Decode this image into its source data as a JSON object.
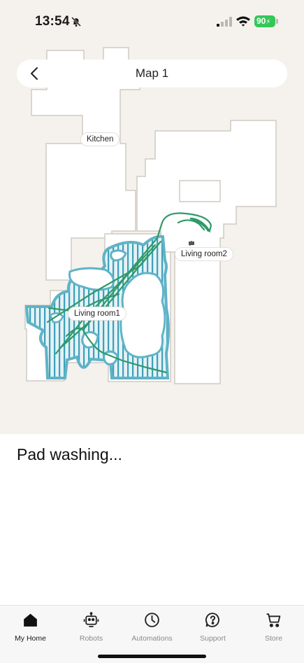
{
  "status_bar": {
    "time": "13:54",
    "battery": "90"
  },
  "header": {
    "title": "Map 1"
  },
  "map": {
    "rooms": [
      {
        "name": "Kitchen"
      },
      {
        "name": "Living room1"
      },
      {
        "name": "Living room2"
      }
    ],
    "colors": {
      "background": "#f5f1ec",
      "floor": "#ffffff",
      "cleaned_area": "#5fb3c8",
      "path": "#2e9968"
    }
  },
  "status": {
    "text": "Pad washing..."
  },
  "tabs": [
    {
      "label": "My Home",
      "icon": "home-icon",
      "active": true
    },
    {
      "label": "Robots",
      "icon": "robot-icon",
      "active": false
    },
    {
      "label": "Automations",
      "icon": "clock-icon",
      "active": false
    },
    {
      "label": "Support",
      "icon": "help-icon",
      "active": false
    },
    {
      "label": "Store",
      "icon": "cart-icon",
      "active": false
    }
  ]
}
